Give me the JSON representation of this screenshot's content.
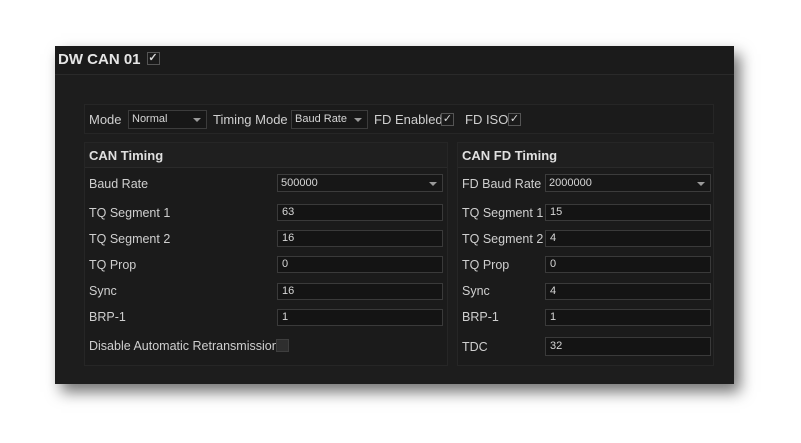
{
  "window": {
    "title": "DW CAN 01",
    "enabled_check": "✓"
  },
  "modebar": {
    "mode_label": "Mode",
    "mode_value": "Normal",
    "timing_mode_label": "Timing Mode",
    "timing_mode_value": "Baud Rate",
    "fd_enabled_label": "FD Enabled",
    "fd_enabled_check": "✓",
    "fd_iso_label": "FD ISO",
    "fd_iso_check": "✓"
  },
  "can_timing": {
    "title": "CAN Timing",
    "baud_rate_label": "Baud Rate",
    "baud_rate_value": "500000",
    "tq_seg1_label": "TQ Segment 1",
    "tq_seg1_value": "63",
    "tq_seg2_label": "TQ Segment 2",
    "tq_seg2_value": "16",
    "tq_prop_label": "TQ Prop",
    "tq_prop_value": "0",
    "sync_label": "Sync",
    "sync_value": "16",
    "brp_label": "BRP-1",
    "brp_value": "1",
    "disable_retx_label": "Disable Automatic Retransmission"
  },
  "can_fd_timing": {
    "title": "CAN FD Timing",
    "fd_baud_rate_label": "FD Baud Rate",
    "fd_baud_rate_value": "2000000",
    "tq_seg1_label": "TQ Segment 1",
    "tq_seg1_value": "15",
    "tq_seg2_label": "TQ Segment 2",
    "tq_seg2_value": "4",
    "tq_prop_label": "TQ Prop",
    "tq_prop_value": "0",
    "sync_label": "Sync",
    "sync_value": "4",
    "brp_label": "BRP-1",
    "brp_value": "1",
    "tdc_label": "TDC",
    "tdc_value": "32"
  }
}
